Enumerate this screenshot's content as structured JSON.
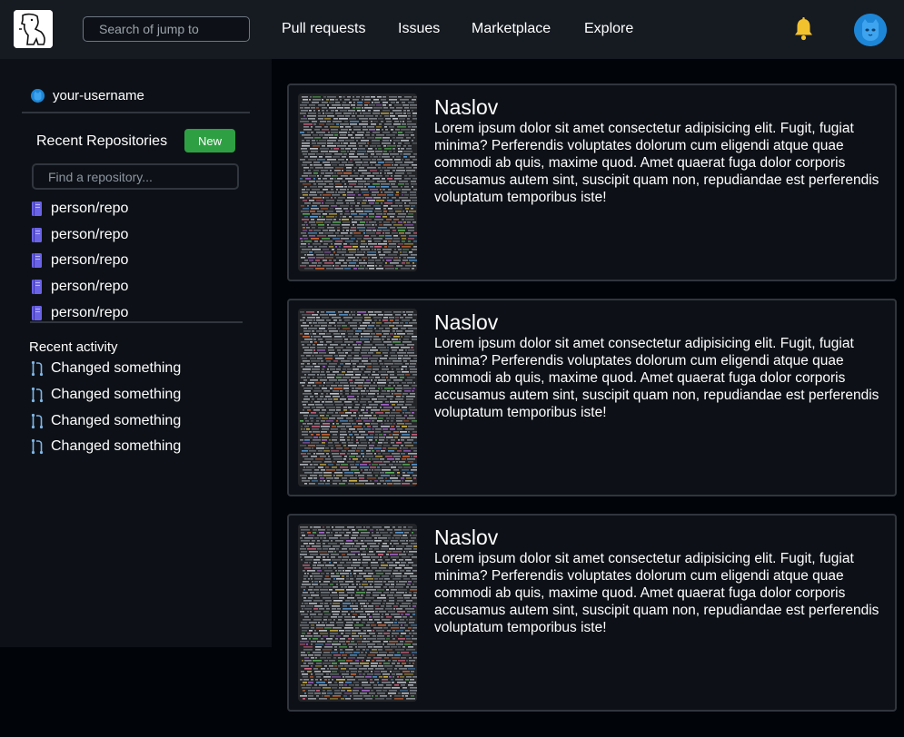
{
  "header": {
    "logo": "dog-logo-icon",
    "search_placeholder": "Search of jump to",
    "nav": [
      "Pull requests",
      "Issues",
      "Marketplace",
      "Explore"
    ],
    "notification_icon": "bell-icon",
    "avatar_icon": "cat-avatar-icon"
  },
  "sidebar": {
    "username": "your-username",
    "recent_repositories_title": "Recent Repositories",
    "new_button": "New",
    "find_placeholder": "Find a repository...",
    "repos": [
      "person/repo",
      "person/repo",
      "person/repo",
      "person/repo",
      "person/repo"
    ],
    "recent_activity_title": "Recent activity",
    "activity": [
      "Changed something",
      "Changed something",
      "Changed something",
      "Changed something"
    ]
  },
  "feed": {
    "cards": [
      {
        "title": "Naslov",
        "body": "Lorem ipsum dolor sit amet consectetur adipisicing elit. Fugit, fugiat minima? Perferendis voluptates dolorum cum eligendi atque quae commodi ab quis, maxime quod. Amet quaerat fuga dolor corporis accusamus autem sint, suscipit quam non, repudiandae est perferendis voluptatum temporibus iste!"
      },
      {
        "title": "Naslov",
        "body": "Lorem ipsum dolor sit amet consectetur adipisicing elit. Fugit, fugiat minima? Perferendis voluptates dolorum cum eligendi atque quae commodi ab quis, maxime quod. Amet quaerat fuga dolor corporis accusamus autem sint, suscipit quam non, repudiandae est perferendis voluptatum temporibus iste!"
      },
      {
        "title": "Naslov",
        "body": "Lorem ipsum dolor sit amet consectetur adipisicing elit. Fugit, fugiat minima? Perferendis voluptates dolorum cum eligendi atque quae commodi ab quis, maxime quod. Amet quaerat fuga dolor corporis accusamus autem sint, suscipit quam non, repudiandae est perferendis voluptatum temporibus iste!"
      }
    ]
  },
  "colors": {
    "page_bg": "#010409",
    "header_bg": "#161b22",
    "panel_bg": "#0d1117",
    "border": "#30363d",
    "new_button": "#2ea043",
    "bell": "#f2c12e",
    "avatar": "#1e86d6",
    "repo_icon": "#6b63e6",
    "activity_icon": "#7fb6e6"
  }
}
